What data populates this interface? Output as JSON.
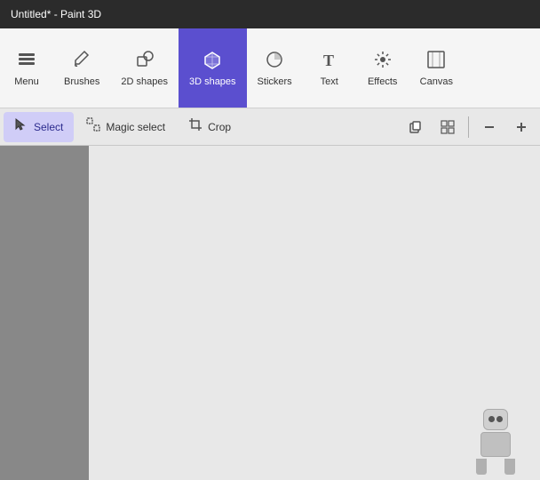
{
  "titleBar": {
    "title": "Untitled* - Paint 3D"
  },
  "toolbar": {
    "items": [
      {
        "id": "menu",
        "label": "Menu",
        "icon": "☰",
        "active": false
      },
      {
        "id": "brushes",
        "label": "Brushes",
        "icon": "✏️",
        "active": false
      },
      {
        "id": "2d-shapes",
        "label": "2D shapes",
        "icon": "⬡",
        "active": false
      },
      {
        "id": "3d-shapes",
        "label": "3D shapes",
        "icon": "⬡",
        "active": true
      },
      {
        "id": "stickers",
        "label": "Stickers",
        "icon": "⊘",
        "active": false
      },
      {
        "id": "text",
        "label": "Text",
        "icon": "T",
        "active": false
      },
      {
        "id": "effects",
        "label": "Effects",
        "icon": "✳",
        "active": false
      },
      {
        "id": "canvas",
        "label": "Canvas",
        "icon": "⊟",
        "active": false
      }
    ]
  },
  "secondaryToolbar": {
    "items": [
      {
        "id": "select",
        "label": "Select",
        "icon": "↖",
        "active": true
      },
      {
        "id": "magic-select",
        "label": "Magic select",
        "icon": "⊡",
        "active": false
      },
      {
        "id": "crop",
        "label": "Crop",
        "icon": "⊓",
        "active": false
      }
    ],
    "rightIcons": [
      {
        "id": "paste",
        "icon": "⊞"
      },
      {
        "id": "grid",
        "icon": "⊞"
      },
      {
        "id": "minus",
        "icon": "−"
      },
      {
        "id": "plus",
        "icon": "+"
      }
    ]
  }
}
